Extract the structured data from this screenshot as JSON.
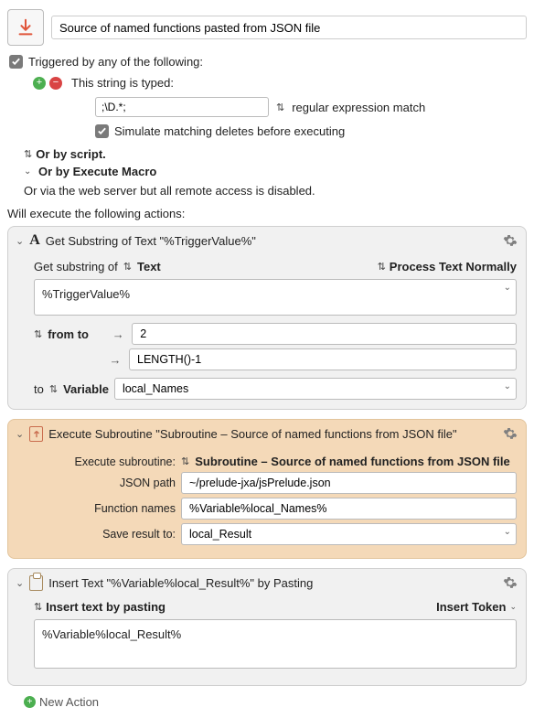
{
  "title": "Source of named functions pasted from JSON file",
  "triggers": {
    "heading": "Triggered by any of the following:",
    "typed_label": "This string is typed:",
    "typed_value": ";\\D.*;",
    "match_mode": "regular expression match",
    "simulate_label": "Simulate matching deletes before executing",
    "or_script": "Or by script.",
    "or_execute_macro": "Or by Execute Macro",
    "or_web": "Or via the web server but all remote access is disabled."
  },
  "execute_heading": "Will execute the following actions:",
  "actions": {
    "substring": {
      "title": "Get Substring of Text \"%TriggerValue%\"",
      "sub_label": "Get substring of",
      "sub_type": "Text",
      "process_label": "Process Text Normally",
      "text_value": "%TriggerValue%",
      "range_label": "from to",
      "from_value": "2",
      "to_value": "LENGTH()-1",
      "to_label": "to",
      "to_type": "Variable",
      "var_name": "local_Names"
    },
    "subroutine": {
      "title": "Execute Subroutine \"Subroutine – Source of named functions from JSON file\"",
      "exec_label": "Execute subroutine:",
      "exec_value": "Subroutine – Source of named functions from JSON file",
      "json_path_label": "JSON path",
      "json_path_value": "~/prelude-jxa/jsPrelude.json",
      "fn_names_label": "Function names",
      "fn_names_value": "%Variable%local_Names%",
      "save_label": "Save result to:",
      "save_value": "local_Result"
    },
    "insert": {
      "title": "Insert Text \"%Variable%local_Result%\" by Pasting",
      "mode_label": "Insert text by pasting",
      "token_label": "Insert Token",
      "text_value": "%Variable%local_Result%"
    }
  },
  "new_action": "New Action"
}
